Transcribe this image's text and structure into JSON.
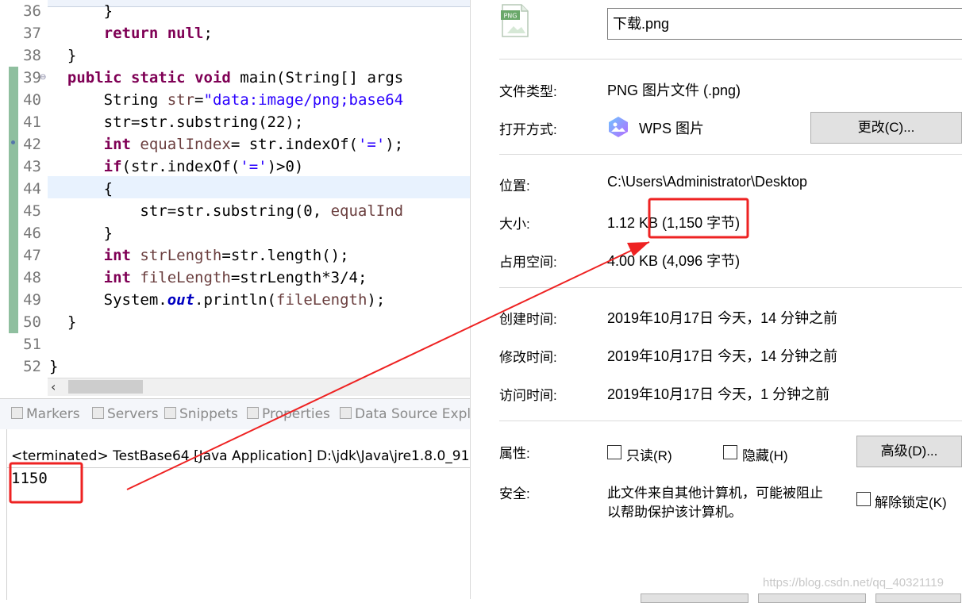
{
  "editor": {
    "lines": [
      {
        "no": "36"
      },
      {
        "no": "37"
      },
      {
        "no": "38"
      },
      {
        "no": "39"
      },
      {
        "no": "40"
      },
      {
        "no": "41"
      },
      {
        "no": "42"
      },
      {
        "no": "43"
      },
      {
        "no": "44"
      },
      {
        "no": "45"
      },
      {
        "no": "46"
      },
      {
        "no": "47"
      },
      {
        "no": "48"
      },
      {
        "no": "49"
      },
      {
        "no": "50"
      },
      {
        "no": "51"
      },
      {
        "no": "52"
      }
    ],
    "code": {
      "l36_brace": "}",
      "l37_return": "return",
      "l37_null": "null",
      "l37_semi": ";",
      "l38": "}",
      "l39_public": "public",
      "l39_static": "static",
      "l39_void": "void",
      "l39_rest": "main(String[] args",
      "l40_type": "String ",
      "l40_var": "str",
      "l40_eq": "=",
      "l40_str": "\"data:image/png;base64",
      "l41": "str=str.substring(22);",
      "l42_int": "int",
      "l42_var": "equalIndex",
      "l42_mid": "= str.indexOf(",
      "l42_str": "'='",
      "l42_end": ");",
      "l43_if": "if",
      "l43_mid": "(str.indexOf(",
      "l43_str": "'='",
      "l43_end": ")>0)",
      "l44": "{",
      "l45_a": "str=str.substring(0, ",
      "l45_var": "equalInd",
      "l46": "}",
      "l47_int": "int",
      "l47_var": "strLength",
      "l47_rest": "=str.length();",
      "l48_int": "int",
      "l48_var": "fileLength",
      "l48_rest": "=strLength*3/4;",
      "l49_a": "System.",
      "l49_out": "out",
      "l49_b": ".println(",
      "l49_var": "fileLength",
      "l49_c": ");",
      "l50": "}",
      "l52": "}"
    }
  },
  "panel": {
    "tabs": [
      "Markers",
      "Servers",
      "Snippets",
      "Properties",
      "Data Source Expl"
    ],
    "console_header": "<terminated> TestBase64 [Java Application] D:\\jdk\\Java\\jre1.8.0_91",
    "console_output": "1150"
  },
  "properties": {
    "icon_badge": "PNG",
    "filename": "下载.png",
    "type_label": "文件类型:",
    "type_value": "PNG 图片文件 (.png)",
    "open_label": "打开方式:",
    "open_value": "WPS 图片",
    "change_button": "更改(C)...",
    "location_label": "位置:",
    "location_value": "C:\\Users\\Administrator\\Desktop",
    "size_label": "大小:",
    "size_value": "1.12 KB (1,150 字节)",
    "disk_label": "占用空间:",
    "disk_value": "4.00 KB (4,096 字节)",
    "created_label": "创建时间:",
    "created_value": "2019年10月17日 今天，14 分钟之前",
    "modified_label": "修改时间:",
    "modified_value": "2019年10月17日 今天，14 分钟之前",
    "accessed_label": "访问时间:",
    "accessed_value": "2019年10月17日 今天，1 分钟之前",
    "attr_label": "属性:",
    "readonly": "只读(R)",
    "hidden": "隐藏(H)",
    "advanced_button": "高级(D)...",
    "security_label": "安全:",
    "security_line1": "此文件来自其他计算机，可能被阻止",
    "security_line2": "以帮助保护该计算机。",
    "unblock": "解除锁定(K)",
    "watermark": "https://blog.csdn.net/qq_40321119"
  },
  "colors": {
    "keyword": "#7f0055",
    "string": "#2a00ff",
    "field": "#0000c0",
    "annotation": "#ee2222"
  }
}
